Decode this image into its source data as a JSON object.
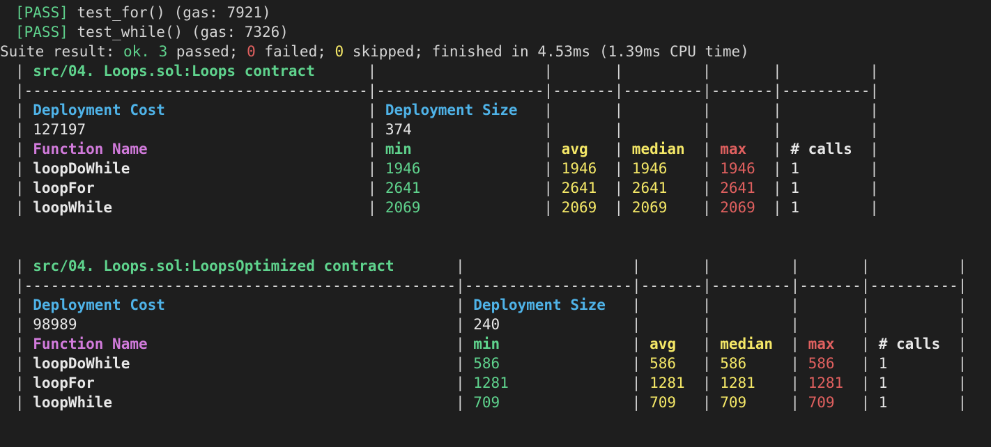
{
  "terminal": {
    "tests": [
      {
        "tag": "[PASS]",
        "text": "test_for() (gas: 7921)"
      },
      {
        "tag": "[PASS]",
        "text": "test_while() (gas: 7326)"
      }
    ],
    "suite": {
      "prefix": "Suite result: ",
      "ok": "ok.",
      "passed_count": "3",
      "passed_label": " passed; ",
      "failed_count": "0",
      "failed_label": " failed; ",
      "skipped_count": "0",
      "skipped_label": " skipped; finished in 4.53ms (1.39ms CPU time)"
    },
    "tables": [
      {
        "title": "src/04. Loops.sol:Loops contract",
        "deployment_cost_label": "Deployment Cost",
        "deployment_size_label": "Deployment Size",
        "deployment_cost": "127197",
        "deployment_size": "374",
        "headers": {
          "name": "Function Name",
          "min": "min",
          "avg": "avg",
          "median": "median",
          "max": "max",
          "calls": "# calls"
        },
        "rows": [
          {
            "name": "loopDoWhile",
            "min": "1946",
            "avg": "1946",
            "median": "1946",
            "max": "1946",
            "calls": "1"
          },
          {
            "name": "loopFor",
            "min": "2641",
            "avg": "2641",
            "median": "2641",
            "max": "2641",
            "calls": "1"
          },
          {
            "name": "loopWhile",
            "min": "2069",
            "avg": "2069",
            "median": "2069",
            "max": "2069",
            "calls": "1"
          }
        ]
      },
      {
        "title": "src/04. Loops.sol:LoopsOptimized contract",
        "deployment_cost_label": "Deployment Cost",
        "deployment_size_label": "Deployment Size",
        "deployment_cost": "98989",
        "deployment_size": "240",
        "headers": {
          "name": "Function Name",
          "min": "min",
          "avg": "avg",
          "median": "median",
          "max": "max",
          "calls": "# calls"
        },
        "rows": [
          {
            "name": "loopDoWhile",
            "min": "586",
            "avg": "586",
            "median": "586",
            "max": "586",
            "calls": "1"
          },
          {
            "name": "loopFor",
            "min": "1281",
            "avg": "1281",
            "median": "1281",
            "max": "1281",
            "calls": "1"
          },
          {
            "name": "loopWhile",
            "min": "709",
            "avg": "709",
            "median": "709",
            "max": "709",
            "calls": "1"
          }
        ]
      }
    ]
  }
}
